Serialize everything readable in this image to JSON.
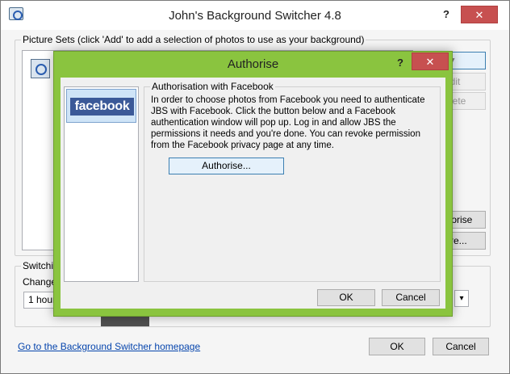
{
  "main_window": {
    "title": "John's Background Switcher 4.8",
    "help_label": "?",
    "close_label": "✕",
    "picture_sets": {
      "legend": "Picture Sets (click 'Add' to add a selection of photos to use as your background)",
      "dropdown_arrow": "▼",
      "edit_label": "Edit",
      "delete_label": "Delete",
      "authorise_label": "Authorise",
      "more_label": "More..."
    },
    "switching": {
      "legend": "Switching",
      "change_label": "Change",
      "interval_value": "1 hour",
      "select_arrow": "▾"
    },
    "homepage_link": "Go to the Background Switcher homepage",
    "ok_label": "OK",
    "cancel_label": "Cancel"
  },
  "auth_dialog": {
    "title": "Authorise",
    "help_label": "?",
    "close_label": "✕",
    "provider": "facebook",
    "group_legend": "Authorisation with Facebook",
    "description": "In order to choose photos from Facebook you need to authenticate JBS with Facebook. Click the button below and a Facebook authentication window will pop up. Log in and allow JBS the permissions it needs and you're done. You can revoke permission from the Facebook privacy page at any time.",
    "authorise_button": "Authorise...",
    "ok_label": "OK",
    "cancel_label": "Cancel"
  },
  "colors": {
    "dialog_frame": "#8ac43f",
    "close_button": "#c75050",
    "facebook_blue": "#3b5998",
    "link": "#0645ad"
  }
}
